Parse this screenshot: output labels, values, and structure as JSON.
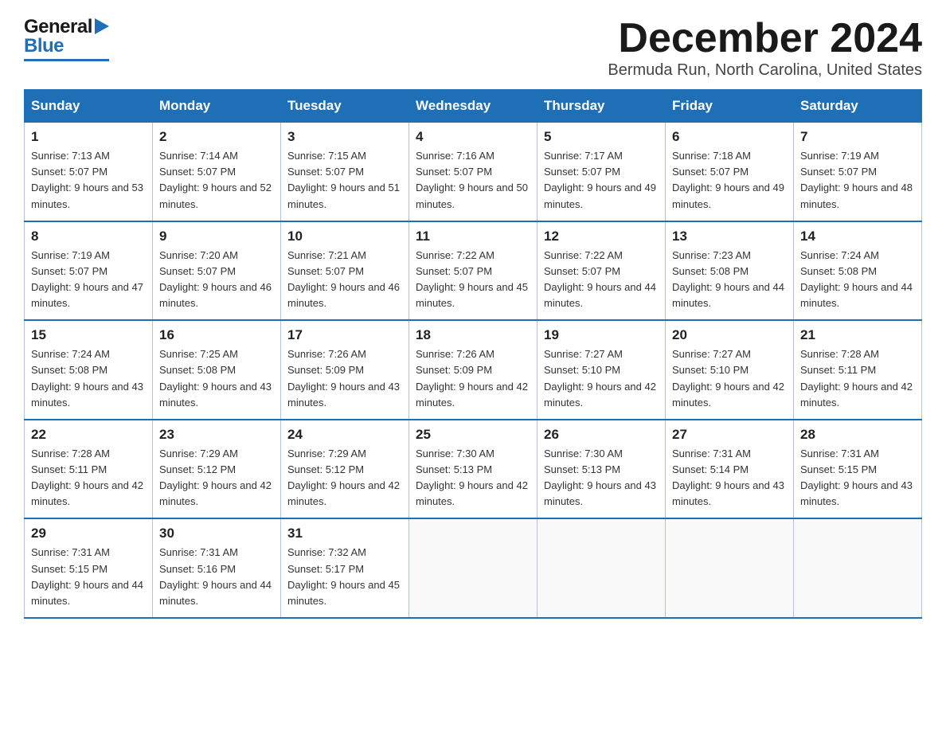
{
  "header": {
    "logo_general": "General",
    "logo_blue": "Blue",
    "title": "December 2024",
    "location": "Bermuda Run, North Carolina, United States"
  },
  "days_of_week": [
    "Sunday",
    "Monday",
    "Tuesday",
    "Wednesday",
    "Thursday",
    "Friday",
    "Saturday"
  ],
  "weeks": [
    [
      {
        "day": "1",
        "sunrise": "7:13 AM",
        "sunset": "5:07 PM",
        "daylight": "9 hours and 53 minutes."
      },
      {
        "day": "2",
        "sunrise": "7:14 AM",
        "sunset": "5:07 PM",
        "daylight": "9 hours and 52 minutes."
      },
      {
        "day": "3",
        "sunrise": "7:15 AM",
        "sunset": "5:07 PM",
        "daylight": "9 hours and 51 minutes."
      },
      {
        "day": "4",
        "sunrise": "7:16 AM",
        "sunset": "5:07 PM",
        "daylight": "9 hours and 50 minutes."
      },
      {
        "day": "5",
        "sunrise": "7:17 AM",
        "sunset": "5:07 PM",
        "daylight": "9 hours and 49 minutes."
      },
      {
        "day": "6",
        "sunrise": "7:18 AM",
        "sunset": "5:07 PM",
        "daylight": "9 hours and 49 minutes."
      },
      {
        "day": "7",
        "sunrise": "7:19 AM",
        "sunset": "5:07 PM",
        "daylight": "9 hours and 48 minutes."
      }
    ],
    [
      {
        "day": "8",
        "sunrise": "7:19 AM",
        "sunset": "5:07 PM",
        "daylight": "9 hours and 47 minutes."
      },
      {
        "day": "9",
        "sunrise": "7:20 AM",
        "sunset": "5:07 PM",
        "daylight": "9 hours and 46 minutes."
      },
      {
        "day": "10",
        "sunrise": "7:21 AM",
        "sunset": "5:07 PM",
        "daylight": "9 hours and 46 minutes."
      },
      {
        "day": "11",
        "sunrise": "7:22 AM",
        "sunset": "5:07 PM",
        "daylight": "9 hours and 45 minutes."
      },
      {
        "day": "12",
        "sunrise": "7:22 AM",
        "sunset": "5:07 PM",
        "daylight": "9 hours and 44 minutes."
      },
      {
        "day": "13",
        "sunrise": "7:23 AM",
        "sunset": "5:08 PM",
        "daylight": "9 hours and 44 minutes."
      },
      {
        "day": "14",
        "sunrise": "7:24 AM",
        "sunset": "5:08 PM",
        "daylight": "9 hours and 44 minutes."
      }
    ],
    [
      {
        "day": "15",
        "sunrise": "7:24 AM",
        "sunset": "5:08 PM",
        "daylight": "9 hours and 43 minutes."
      },
      {
        "day": "16",
        "sunrise": "7:25 AM",
        "sunset": "5:08 PM",
        "daylight": "9 hours and 43 minutes."
      },
      {
        "day": "17",
        "sunrise": "7:26 AM",
        "sunset": "5:09 PM",
        "daylight": "9 hours and 43 minutes."
      },
      {
        "day": "18",
        "sunrise": "7:26 AM",
        "sunset": "5:09 PM",
        "daylight": "9 hours and 42 minutes."
      },
      {
        "day": "19",
        "sunrise": "7:27 AM",
        "sunset": "5:10 PM",
        "daylight": "9 hours and 42 minutes."
      },
      {
        "day": "20",
        "sunrise": "7:27 AM",
        "sunset": "5:10 PM",
        "daylight": "9 hours and 42 minutes."
      },
      {
        "day": "21",
        "sunrise": "7:28 AM",
        "sunset": "5:11 PM",
        "daylight": "9 hours and 42 minutes."
      }
    ],
    [
      {
        "day": "22",
        "sunrise": "7:28 AM",
        "sunset": "5:11 PM",
        "daylight": "9 hours and 42 minutes."
      },
      {
        "day": "23",
        "sunrise": "7:29 AM",
        "sunset": "5:12 PM",
        "daylight": "9 hours and 42 minutes."
      },
      {
        "day": "24",
        "sunrise": "7:29 AM",
        "sunset": "5:12 PM",
        "daylight": "9 hours and 42 minutes."
      },
      {
        "day": "25",
        "sunrise": "7:30 AM",
        "sunset": "5:13 PM",
        "daylight": "9 hours and 42 minutes."
      },
      {
        "day": "26",
        "sunrise": "7:30 AM",
        "sunset": "5:13 PM",
        "daylight": "9 hours and 43 minutes."
      },
      {
        "day": "27",
        "sunrise": "7:31 AM",
        "sunset": "5:14 PM",
        "daylight": "9 hours and 43 minutes."
      },
      {
        "day": "28",
        "sunrise": "7:31 AM",
        "sunset": "5:15 PM",
        "daylight": "9 hours and 43 minutes."
      }
    ],
    [
      {
        "day": "29",
        "sunrise": "7:31 AM",
        "sunset": "5:15 PM",
        "daylight": "9 hours and 44 minutes."
      },
      {
        "day": "30",
        "sunrise": "7:31 AM",
        "sunset": "5:16 PM",
        "daylight": "9 hours and 44 minutes."
      },
      {
        "day": "31",
        "sunrise": "7:32 AM",
        "sunset": "5:17 PM",
        "daylight": "9 hours and 45 minutes."
      },
      null,
      null,
      null,
      null
    ]
  ]
}
